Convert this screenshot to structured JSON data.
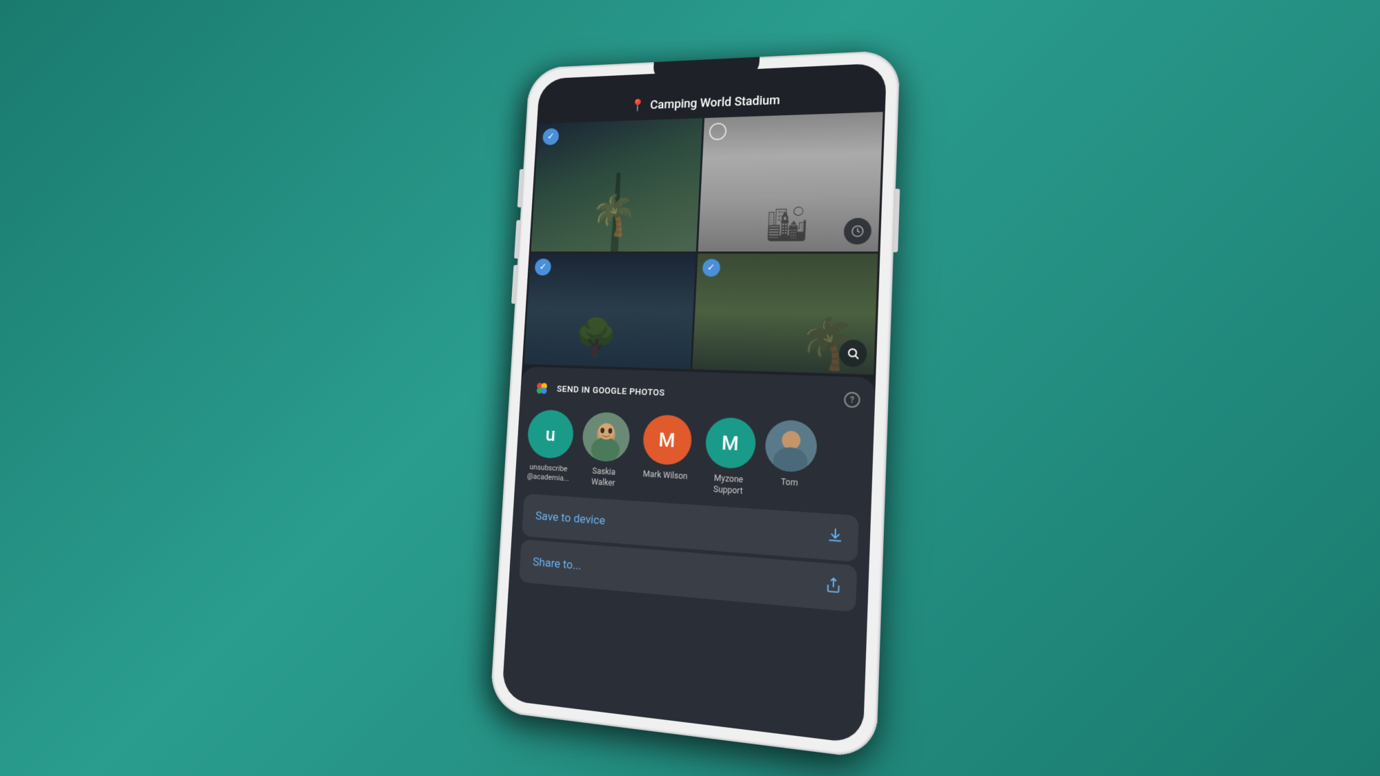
{
  "background": {
    "color_start": "#1a7a6e",
    "color_end": "#2a9d8f"
  },
  "phone": {
    "location_bar": {
      "pin_icon": "📍",
      "location_name": "Camping World Stadium"
    },
    "photos": [
      {
        "id": 1,
        "checked": true,
        "check_type": "filled"
      },
      {
        "id": 2,
        "checked": false,
        "check_type": "outline",
        "has_clock": true
      },
      {
        "id": 3,
        "checked": true,
        "check_type": "filled"
      },
      {
        "id": 4,
        "checked": true,
        "check_type": "filled"
      }
    ],
    "share_panel": {
      "title": "SEND IN GOOGLE PHOTOS",
      "help_label": "?",
      "contacts": [
        {
          "id": "unsubscribe",
          "initials": "u",
          "avatar_type": "letter",
          "avatar_color": "teal",
          "name": "unsubscribe\n@academia..."
        },
        {
          "id": "saskia",
          "avatar_type": "photo",
          "name": "Saskia\nWalker"
        },
        {
          "id": "mark",
          "initials": "M",
          "avatar_type": "letter",
          "avatar_color": "orange",
          "name": "Mark Wilson"
        },
        {
          "id": "myzone",
          "initials": "M",
          "avatar_type": "letter",
          "avatar_color": "teal",
          "name": "Myzone\nSupport"
        },
        {
          "id": "tom",
          "avatar_type": "photo",
          "name": "Tom"
        }
      ],
      "actions": [
        {
          "id": "save-device",
          "label": "Save to device",
          "icon": "⬇"
        },
        {
          "id": "share-to",
          "label": "Share to...",
          "icon": "↑"
        }
      ]
    }
  }
}
